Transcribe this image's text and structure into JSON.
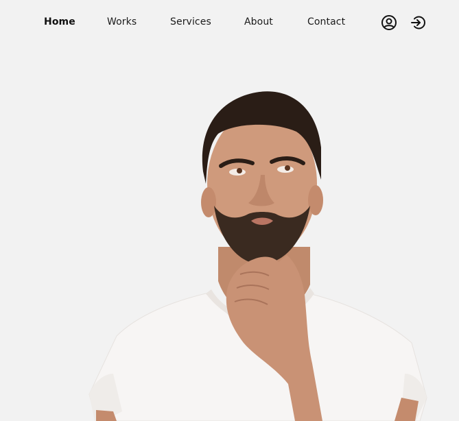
{
  "nav": {
    "items": [
      {
        "label": "Home",
        "active": true
      },
      {
        "label": "Works",
        "active": false
      },
      {
        "label": "Services",
        "active": false
      },
      {
        "label": "About",
        "active": false
      },
      {
        "label": "Contact",
        "active": false
      }
    ],
    "icons": {
      "account": "user-circle-icon",
      "login": "login-arrow-icon"
    }
  },
  "hero": {
    "image": "thinking-man-portrait",
    "colors": {
      "background": "#f2f2f2",
      "skin": "#c99275",
      "hair": "#2a1d16",
      "shirt": "#f7f5f4"
    }
  }
}
